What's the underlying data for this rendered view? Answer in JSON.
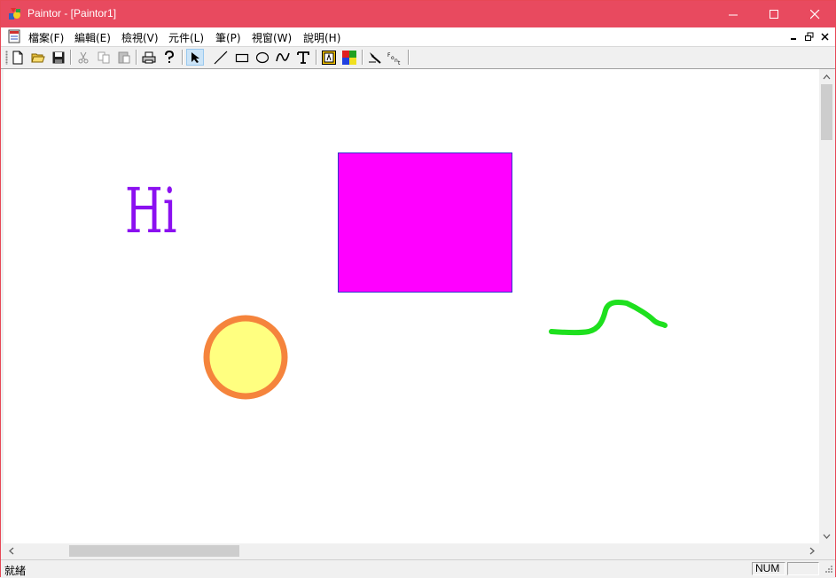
{
  "window": {
    "title": "Paintor - [Paintor1]"
  },
  "menubar": {
    "items": [
      {
        "label": "檔案(F)"
      },
      {
        "label": "編輯(E)"
      },
      {
        "label": "檢視(V)"
      },
      {
        "label": "元件(L)"
      },
      {
        "label": "筆(P)"
      },
      {
        "label": "視窗(W)"
      },
      {
        "label": "說明(H)"
      }
    ]
  },
  "toolbar": {
    "buttons": [
      "new",
      "open",
      "save",
      "cut",
      "copy",
      "paste",
      "print",
      "help",
      "select",
      "line",
      "rectangle",
      "ellipse",
      "freehand",
      "text",
      "pen-color",
      "fill-color",
      "pen-style",
      "font"
    ],
    "active_tool": "select"
  },
  "canvas": {
    "text_object": {
      "text": "Hi",
      "color": "#8b10f0"
    },
    "rectangle": {
      "fill": "#ff00ff",
      "stroke": "#3333cc"
    },
    "circle": {
      "fill": "#ffff80",
      "stroke": "#f5843c"
    },
    "freehand": {
      "stroke": "#1ee01e"
    }
  },
  "statusbar": {
    "message": "就緒",
    "num_indicator": "NUM"
  },
  "colors": {
    "titlebar": "#e84a5f",
    "background": "#ffffff"
  }
}
